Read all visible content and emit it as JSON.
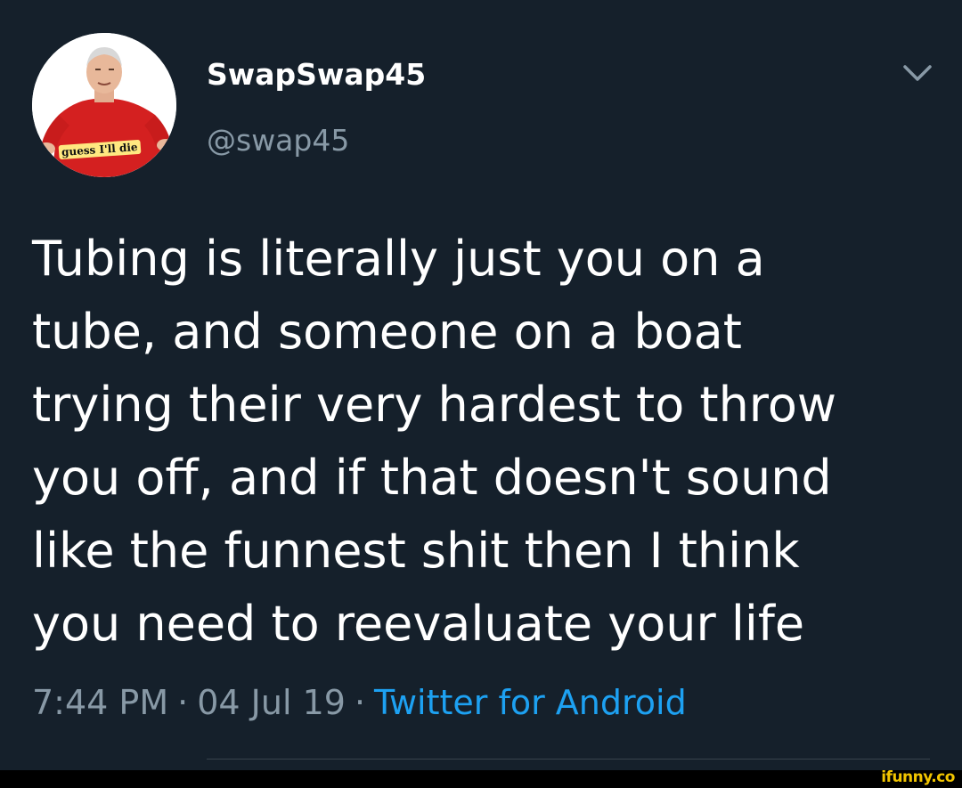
{
  "user": {
    "display_name": "SwapSwap45",
    "handle": "@swap45",
    "avatar_caption": "guess I'll die"
  },
  "tweet": {
    "text": "Tubing is literally just you on a\ntube, and someone on a boat\ntrying their very hardest to throw\nyou off, and if that doesn't sound\nlike the funnest shit then I think\nyou need to reevaluate your life",
    "time": "7:44 PM",
    "date": "04 Jul 19",
    "separator": "·",
    "source": "Twitter for Android"
  },
  "watermark": "ifunny.co",
  "icons": {
    "menu": "chevron-down-icon"
  },
  "colors": {
    "background": "#15202b",
    "text": "#ffffff",
    "secondary": "#8899a6",
    "link": "#1da1f2",
    "watermark": "#f2c500"
  }
}
